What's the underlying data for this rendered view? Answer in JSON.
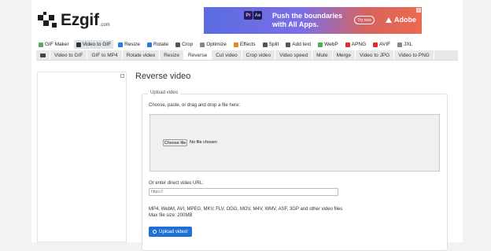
{
  "logo": {
    "name": "Ezgif",
    "tld": ".com"
  },
  "ad_banner": {
    "badge1": "Pr",
    "badge2": "Ae",
    "headline_line1": "Push the boundaries",
    "headline_line2": "with All Apps.",
    "cta": "Try now",
    "brand": "Adobe"
  },
  "main_nav": [
    {
      "label": "GIF Maker",
      "icon": "gif-maker-icon",
      "color": "#5fa85f",
      "active": false
    },
    {
      "label": "Video to GIF",
      "icon": "video-icon",
      "color": "#333333",
      "active": true
    },
    {
      "label": "Resize",
      "icon": "resize-icon",
      "color": "#2a7bd6",
      "active": false
    },
    {
      "label": "Rotate",
      "icon": "rotate-icon",
      "color": "#2a7bd6",
      "active": false
    },
    {
      "label": "Crop",
      "icon": "crop-icon",
      "color": "#555555",
      "active": false
    },
    {
      "label": "Optimize",
      "icon": "optimize-icon",
      "color": "#888888",
      "active": false
    },
    {
      "label": "Effects",
      "icon": "effects-icon",
      "color": "#e08a2a",
      "active": false
    },
    {
      "label": "Split",
      "icon": "split-icon",
      "color": "#555555",
      "active": false
    },
    {
      "label": "Add text",
      "icon": "add-text-icon",
      "color": "#555555",
      "active": false
    },
    {
      "label": "WebP",
      "icon": "webp-icon",
      "color": "#4caf50",
      "active": false
    },
    {
      "label": "APNG",
      "icon": "apng-icon",
      "color": "#d9302c",
      "active": false
    },
    {
      "label": "AVIF",
      "icon": "avif-icon",
      "color": "#d9302c",
      "active": false
    },
    {
      "label": "JXL",
      "icon": "jxl-icon",
      "color": "#888888",
      "active": false
    }
  ],
  "sub_nav": [
    {
      "label": "Video to GIF",
      "active": false
    },
    {
      "label": "GIF to MP4",
      "active": false
    },
    {
      "label": "Rotate video",
      "active": false
    },
    {
      "label": "Resize",
      "active": false
    },
    {
      "label": "Reverse",
      "active": true
    },
    {
      "label": "Cut video",
      "active": false
    },
    {
      "label": "Crop video",
      "active": false
    },
    {
      "label": "Video speed",
      "active": false
    },
    {
      "label": "Mute",
      "active": false
    },
    {
      "label": "Merge",
      "active": false
    },
    {
      "label": "Video to JPG",
      "active": false
    },
    {
      "label": "Video to PNG",
      "active": false
    }
  ],
  "page": {
    "title": "Reverse video",
    "legend": "Upload video",
    "choose_label": "Choose, paste, or drag and drop a file here:",
    "file_button": "Choose file",
    "file_status": "No file chosen",
    "url_label": "Or enter direct video URL:",
    "url_placeholder": "https://",
    "formats_line": "MP4, WebM, AVI, MPEG, MKV, FLV, OGG, MOV, M4V, WMV, ASF, 3GP and other video files",
    "max_size": "Max file size: 200MB",
    "upload_button": "Upload video!"
  },
  "colors": {
    "accent": "#1f6fd6",
    "subnav_bg": "#e8e8e8",
    "active_tab": "#dde3ea"
  }
}
